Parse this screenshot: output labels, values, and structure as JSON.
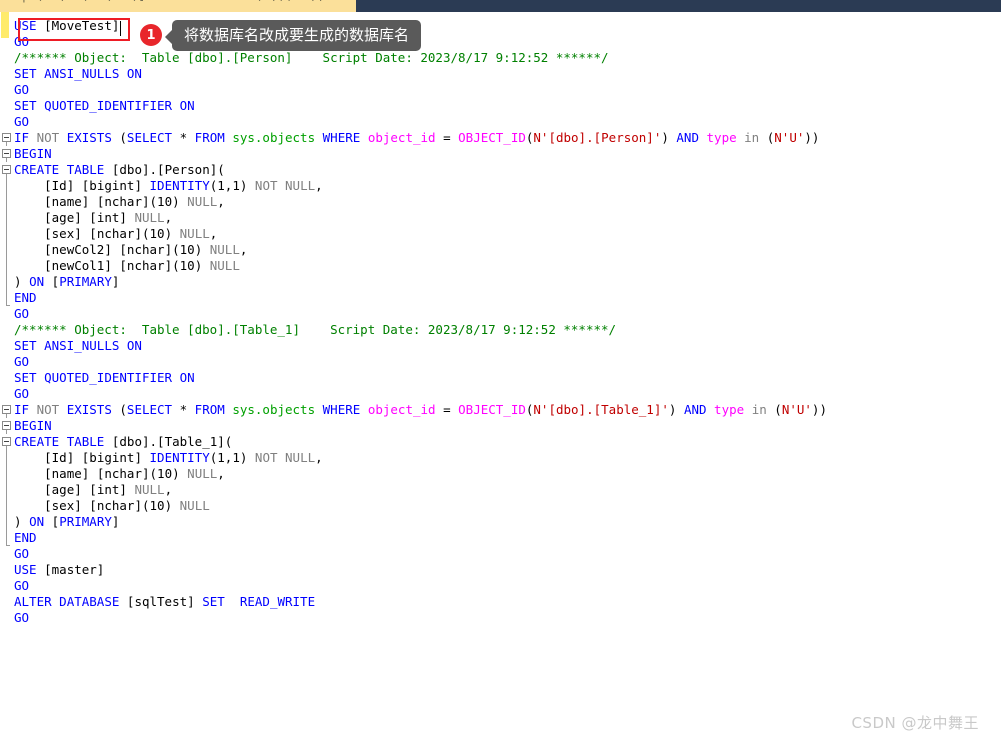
{
  "window": {
    "chrome_ghost_text": "| (  ,  )  ,  ([              ( ,))  ,,",
    "chrome_left_color": "#fbe09a",
    "chrome_right_color": "#2b3b54"
  },
  "editor": {
    "background": "#ffffff",
    "change_bar_color": "#ffeb6b",
    "colors": {
      "keyword": "#0000ff",
      "comment": "#008000",
      "gray": "#808080",
      "system_object": "#00a000",
      "function": "#ff00ff",
      "string": "#c00000",
      "plain": "#000000",
      "highlight_box": "#ee1c25"
    },
    "lines": [
      {
        "id": 1,
        "fold": "none",
        "text": "USE [MoveTest]"
      },
      {
        "id": 2,
        "fold": "none",
        "text": "GO"
      },
      {
        "id": 3,
        "fold": "none",
        "text": "/****** Object:  Table [dbo].[Person]    Script Date: 2023/8/17 9:12:52 ******/"
      },
      {
        "id": 4,
        "fold": "none",
        "text": "SET ANSI_NULLS ON"
      },
      {
        "id": 5,
        "fold": "none",
        "text": "GO"
      },
      {
        "id": 6,
        "fold": "none",
        "text": "SET QUOTED_IDENTIFIER ON"
      },
      {
        "id": 7,
        "fold": "none",
        "text": "GO"
      },
      {
        "id": 8,
        "fold": "box",
        "text": "IF NOT EXISTS (SELECT * FROM sys.objects WHERE object_id = OBJECT_ID(N'[dbo].[Person]') AND type in (N'U'))"
      },
      {
        "id": 9,
        "fold": "box",
        "text": "BEGIN"
      },
      {
        "id": 10,
        "fold": "box",
        "text": "CREATE TABLE [dbo].[Person]("
      },
      {
        "id": 11,
        "fold": "bar",
        "text": "    [Id] [bigint] IDENTITY(1,1) NOT NULL,"
      },
      {
        "id": 12,
        "fold": "bar",
        "text": "    [name] [nchar](10) NULL,"
      },
      {
        "id": 13,
        "fold": "bar",
        "text": "    [age] [int] NULL,"
      },
      {
        "id": 14,
        "fold": "bar",
        "text": "    [sex] [nchar](10) NULL,"
      },
      {
        "id": 15,
        "fold": "bar",
        "text": "    [newCol2] [nchar](10) NULL,"
      },
      {
        "id": 16,
        "fold": "bar",
        "text": "    [newCol1] [nchar](10) NULL"
      },
      {
        "id": 17,
        "fold": "bar",
        "text": ") ON [PRIMARY]"
      },
      {
        "id": 18,
        "fold": "end",
        "text": "END"
      },
      {
        "id": 19,
        "fold": "none",
        "text": "GO"
      },
      {
        "id": 20,
        "fold": "none",
        "text": "/****** Object:  Table [dbo].[Table_1]    Script Date: 2023/8/17 9:12:52 ******/"
      },
      {
        "id": 21,
        "fold": "none",
        "text": "SET ANSI_NULLS ON"
      },
      {
        "id": 22,
        "fold": "none",
        "text": "GO"
      },
      {
        "id": 23,
        "fold": "none",
        "text": "SET QUOTED_IDENTIFIER ON"
      },
      {
        "id": 24,
        "fold": "none",
        "text": "GO"
      },
      {
        "id": 25,
        "fold": "box",
        "text": "IF NOT EXISTS (SELECT * FROM sys.objects WHERE object_id = OBJECT_ID(N'[dbo].[Table_1]') AND type in (N'U'))"
      },
      {
        "id": 26,
        "fold": "box",
        "text": "BEGIN"
      },
      {
        "id": 27,
        "fold": "box",
        "text": "CREATE TABLE [dbo].[Table_1]("
      },
      {
        "id": 28,
        "fold": "bar",
        "text": "    [Id] [bigint] IDENTITY(1,1) NOT NULL,"
      },
      {
        "id": 29,
        "fold": "bar",
        "text": "    [name] [nchar](10) NULL,"
      },
      {
        "id": 30,
        "fold": "bar",
        "text": "    [age] [int] NULL,"
      },
      {
        "id": 31,
        "fold": "bar",
        "text": "    [sex] [nchar](10) NULL"
      },
      {
        "id": 32,
        "fold": "bar",
        "text": ") ON [PRIMARY]"
      },
      {
        "id": 33,
        "fold": "end",
        "text": "END"
      },
      {
        "id": 34,
        "fold": "none",
        "text": "GO"
      },
      {
        "id": 35,
        "fold": "none",
        "text": "USE [master]"
      },
      {
        "id": 36,
        "fold": "none",
        "text": "GO"
      },
      {
        "id": 37,
        "fold": "none",
        "text": "ALTER DATABASE [sqlTest] SET  READ_WRITE"
      },
      {
        "id": 38,
        "fold": "none",
        "text": "GO"
      }
    ]
  },
  "annotation": {
    "badge_number": "1",
    "tooltip_text": "将数据库名改成要生成的数据库名",
    "highlighted_code": "USE [MoveTest]",
    "badge_color": "#e8262b",
    "bubble_color": "#5a5a5a"
  },
  "watermark": {
    "text": "CSDN @龙中舞王"
  }
}
